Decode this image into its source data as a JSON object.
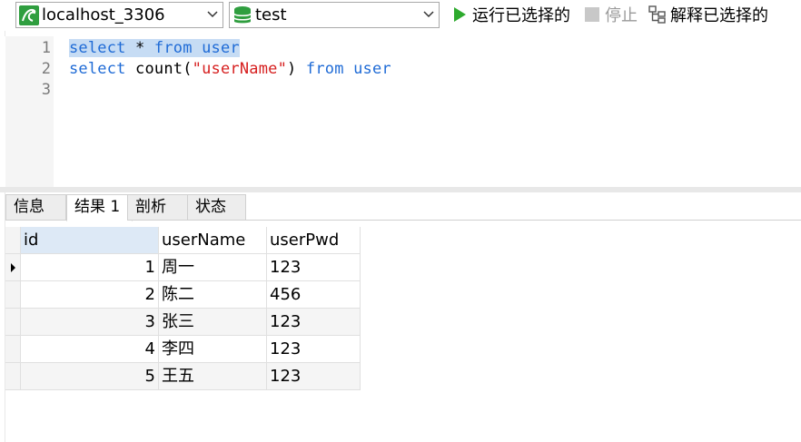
{
  "toolbar": {
    "connection": "localhost_3306",
    "database": "test",
    "run_selected_label": "运行已选择的",
    "stop_label": "停止",
    "explain_selected_label": "解释已选择的"
  },
  "editor": {
    "line_numbers": [
      "1",
      "2",
      "3"
    ],
    "lines": [
      [
        {
          "t": "select",
          "c": "kw"
        },
        {
          "t": " * ",
          "c": "plain"
        },
        {
          "t": "from",
          "c": "kw"
        },
        {
          "t": " ",
          "c": "plain"
        },
        {
          "t": "user",
          "c": "kw"
        }
      ],
      [
        {
          "t": "select",
          "c": "kw"
        },
        {
          "t": " count(",
          "c": "plain"
        },
        {
          "t": "\"userName\"",
          "c": "str"
        },
        {
          "t": ") ",
          "c": "plain"
        },
        {
          "t": "from",
          "c": "kw"
        },
        {
          "t": " ",
          "c": "plain"
        },
        {
          "t": "user",
          "c": "kw"
        }
      ],
      []
    ],
    "selected_line": 1
  },
  "tabs": [
    {
      "label": "信息",
      "active": false
    },
    {
      "label": "结果 1",
      "active": true
    },
    {
      "label": "剖析",
      "active": false
    },
    {
      "label": "状态",
      "active": false
    }
  ],
  "table": {
    "columns": [
      "id",
      "userName",
      "userPwd"
    ],
    "rows": [
      [
        "1",
        "周一",
        "123"
      ],
      [
        "2",
        "陈二",
        "456"
      ],
      [
        "3",
        "张三",
        "123"
      ],
      [
        "4",
        "李四",
        "123"
      ],
      [
        "5",
        "王五",
        "123"
      ]
    ],
    "current_row": 1
  },
  "colors": {
    "keyword": "#1f6bd6",
    "string": "#d61f1f",
    "selection": "#c6dcf4",
    "run_green": "#2eaa2e"
  },
  "icons": [
    "mysql-connection-icon",
    "database-icon",
    "chevron-down-icon",
    "play-icon",
    "stop-icon",
    "explain-icon",
    "row-pointer-icon"
  ]
}
